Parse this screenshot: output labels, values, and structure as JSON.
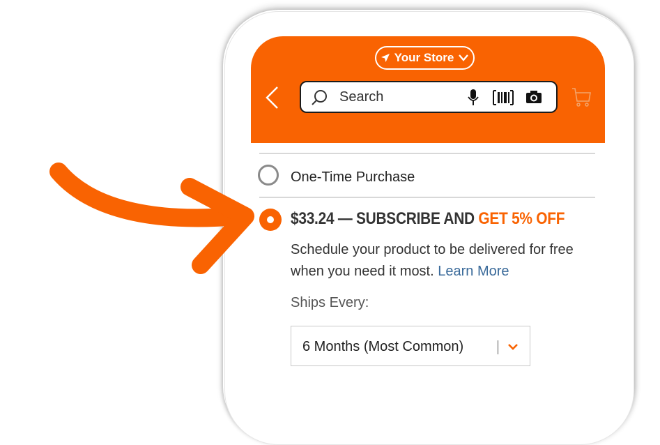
{
  "header": {
    "store_label": "Your Store",
    "search_placeholder": "Search"
  },
  "purchase_options": {
    "one_time_label": "One-Time Purchase",
    "subscribe_price": "$33.24",
    "subscribe_dash": " — ",
    "subscribe_label": "SUBSCRIBE AND ",
    "subscribe_discount": "GET 5% OFF",
    "description": "Schedule your product to be delivered for free when you need it most.",
    "learn_more": "Learn More",
    "ships_label": "Ships Every:",
    "frequency_selected": "6 Months (Most Common)"
  },
  "colors": {
    "brand_orange": "#f96302",
    "link_blue": "#3a6a9a"
  },
  "icons": [
    "location-arrow-icon",
    "chevron-down-icon",
    "back-chevron-icon",
    "search-icon",
    "microphone-icon",
    "barcode-icon",
    "camera-icon",
    "cart-icon",
    "pointer-arrow"
  ]
}
